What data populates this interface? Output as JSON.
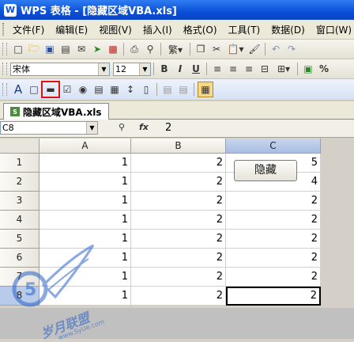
{
  "window": {
    "title": "WPS 表格 - [隐藏区域VBA.xls]"
  },
  "menu": {
    "items": [
      "文件(F)",
      "编辑(E)",
      "视图(V)",
      "插入(I)",
      "格式(O)",
      "工具(T)",
      "数据(D)",
      "窗口(W)"
    ]
  },
  "format_toolbar": {
    "font_name": "宋体",
    "font_size": "12",
    "bold": "B",
    "italic": "I",
    "underline": "U",
    "percent": "%"
  },
  "sheet_tab": {
    "label": "隐藏区域VBA.xls"
  },
  "formula_bar": {
    "name_box": "C8",
    "fx_label": "fx",
    "value": "2"
  },
  "columns": [
    "A",
    "B",
    "C"
  ],
  "rows": [
    {
      "num": "1",
      "A": "1",
      "B": "2",
      "C": "5"
    },
    {
      "num": "2",
      "A": "1",
      "B": "2",
      "C": "4"
    },
    {
      "num": "3",
      "A": "1",
      "B": "2",
      "C": "2"
    },
    {
      "num": "4",
      "A": "1",
      "B": "2",
      "C": "2"
    },
    {
      "num": "5",
      "A": "1",
      "B": "2",
      "C": "2"
    },
    {
      "num": "6",
      "A": "1",
      "B": "2",
      "C": "2"
    },
    {
      "num": "7",
      "A": "1",
      "B": "2",
      "C": "2"
    },
    {
      "num": "8",
      "A": "1",
      "B": "2",
      "C": "2"
    }
  ],
  "sheet_button": {
    "label": "隐藏"
  },
  "watermark": {
    "text": "岁月联盟",
    "url": "www.SyUe.com"
  },
  "colors": {
    "title_bar": "#0a4fd8",
    "highlight_box": "#e01010",
    "selected_header": "#b9cbea"
  }
}
